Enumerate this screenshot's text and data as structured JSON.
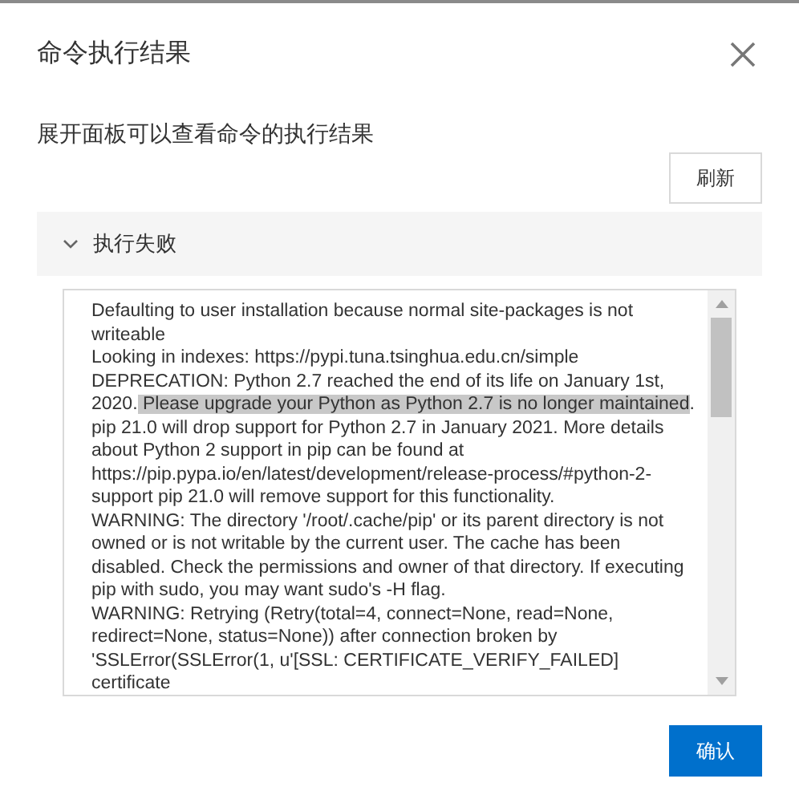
{
  "dialog": {
    "title": "命令执行结果",
    "description": "展开面板可以查看命令的执行结果",
    "refresh_button": "刷新",
    "panel": {
      "title": "执行失败",
      "expanded": true,
      "log": [
        {
          "text": "Defaulting to user installation because normal site-packages is not writeable\nLooking in indexes: https://pypi.tuna.tsinghua.edu.cn/simple\nDEPRECATION: Python 2.7 reached the end of its life on January 1st, 2020.",
          "selected": false
        },
        {
          "text": " Please upgrade your Python as Python 2.7 is no longer maintained",
          "selected": true
        },
        {
          "text": ". pip 21.0 will drop support for Python 2.7 in January 2021. More details about Python 2 support in pip can be found at https://pip.pypa.io/en/latest/development/release-process/#python-2-support pip 21.0 will remove support for this functionality.\nWARNING: The directory '/root/.cache/pip' or its parent directory is not owned or is not writable by the current user. The cache has been disabled. Check the permissions and owner of that directory. If executing pip with sudo, you may want sudo's -H flag.\nWARNING: Retrying (Retry(total=4, connect=None, read=None, redirect=None, status=None)) after connection broken by 'SSLError(SSLError(1, u'[SSL: CERTIFICATE_VERIFY_FAILED] certificate",
          "selected": false
        }
      ]
    },
    "confirm_button": "确认"
  }
}
